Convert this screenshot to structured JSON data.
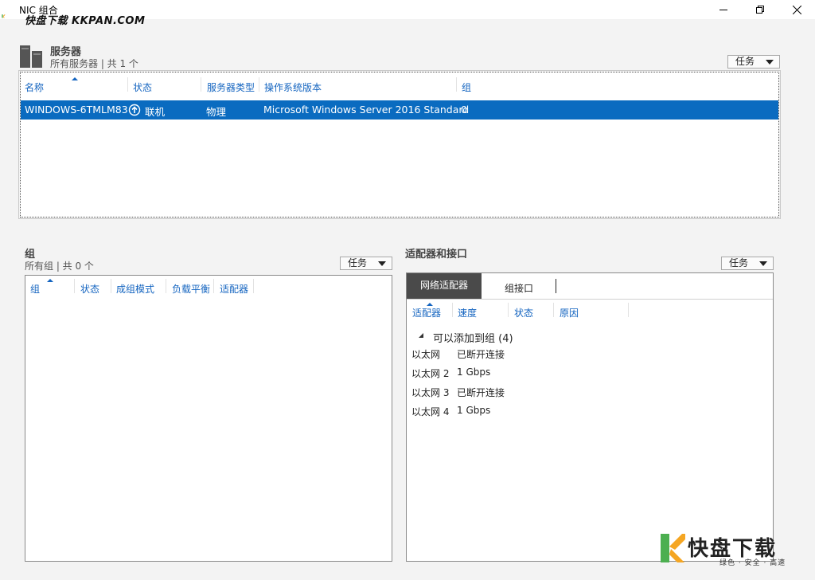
{
  "window": {
    "title": "NIC 组合",
    "watermark_top": "快盘下载 KKPAN.COM",
    "controls": {
      "minimize": "minimize",
      "maximize": "restore",
      "close": "close"
    }
  },
  "servers": {
    "title": "服务器",
    "subtitle": "所有服务器 | 共 1 个",
    "tasks_label": "任务",
    "columns": [
      "名称",
      "状态",
      "服务器类型",
      "操作系统版本",
      "组"
    ],
    "rows": [
      {
        "name": "WINDOWS-6TMLM83",
        "status": "联机",
        "type": "物理",
        "os": "Microsoft Windows Server 2016 Standard",
        "teams": "0"
      }
    ]
  },
  "teams": {
    "title": "组",
    "subtitle": "所有组 | 共 0 个",
    "tasks_label": "任务",
    "columns": [
      "组",
      "状态",
      "成组模式",
      "负载平衡",
      "适配器"
    ]
  },
  "adapters": {
    "title": "适配器和接口",
    "tasks_label": "任务",
    "tabs": [
      "网络适配器",
      "组接口"
    ],
    "active_tab": "网络适配器",
    "columns": [
      "适配器",
      "速度",
      "状态",
      "原因"
    ],
    "group_header": "可以添加到组 (4)",
    "rows": [
      {
        "adapter": "以太网",
        "speed": "已断开连接"
      },
      {
        "adapter": "以太网 2",
        "speed": "1 Gbps"
      },
      {
        "adapter": "以太网 3",
        "speed": "已断开连接"
      },
      {
        "adapter": "以太网 4",
        "speed": "1 Gbps"
      }
    ]
  },
  "watermark_bottom": {
    "main": "快盘下载",
    "sub": "绿色 · 安全 · 高速"
  },
  "colors": {
    "selection": "#0a6bc0",
    "column_header": "#1565c0",
    "watermark_orange": "#f5a623",
    "watermark_green": "#4caf50"
  }
}
